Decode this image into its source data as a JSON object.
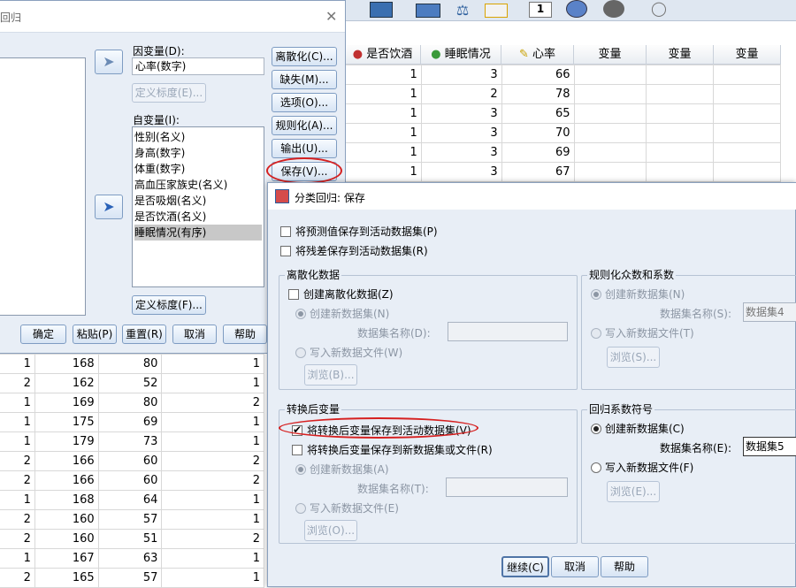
{
  "left_dialog": {
    "title_fragment": "回归",
    "dependent_label": "因变量(D):",
    "dependent_value": "心率(数字)",
    "define_scale_dep": "定义标度(E)...",
    "independent_label": "自变量(I):",
    "independent_items": [
      "性别(名义)",
      "身高(数字)",
      "体重(数字)",
      "高血压家族史(名义)",
      "是否吸烟(名义)",
      "是否饮酒(名义)",
      "睡眠情况(有序)"
    ],
    "define_scale_indep": "定义标度(F)...",
    "side_buttons": [
      "离散化(C)...",
      "缺失(M)...",
      "选项(O)...",
      "规则化(A)...",
      "输出(U)...",
      "保存(V)..."
    ],
    "bottom_buttons": [
      "确定",
      "粘贴(P)",
      "重置(R)",
      "取消",
      "帮助"
    ]
  },
  "top_grid": {
    "headers": [
      "是否饮酒",
      "睡眠情况",
      "心率",
      "变量",
      "变量",
      "变量"
    ],
    "rows": [
      [
        "1",
        "3",
        "66"
      ],
      [
        "1",
        "2",
        "78"
      ],
      [
        "1",
        "3",
        "65"
      ],
      [
        "1",
        "3",
        "70"
      ],
      [
        "1",
        "3",
        "69"
      ],
      [
        "1",
        "3",
        "67"
      ]
    ]
  },
  "bottom_grid": {
    "rows": [
      [
        "1",
        "168",
        "80",
        "1"
      ],
      [
        "2",
        "162",
        "52",
        "1"
      ],
      [
        "1",
        "169",
        "80",
        "2"
      ],
      [
        "1",
        "175",
        "69",
        "1"
      ],
      [
        "1",
        "179",
        "73",
        "1"
      ],
      [
        "2",
        "166",
        "60",
        "2"
      ],
      [
        "2",
        "166",
        "60",
        "2"
      ],
      [
        "1",
        "168",
        "64",
        "1"
      ],
      [
        "2",
        "160",
        "57",
        "1"
      ],
      [
        "2",
        "160",
        "51",
        "2"
      ],
      [
        "1",
        "167",
        "63",
        "1"
      ],
      [
        "2",
        "165",
        "57",
        "1"
      ]
    ]
  },
  "save_dialog": {
    "title": "分类回归: 保存",
    "save_predicted": "将预测值保存到活动数据集(P)",
    "save_residuals": "将残差保存到活动数据集(R)",
    "discretized_group": {
      "title": "离散化数据",
      "create_discretized": "创建离散化数据(Z)",
      "create_new_dataset": "创建新数据集(N)",
      "dataset_name_label": "数据集名称(D):",
      "write_new_file": "写入新数据文件(W)",
      "browse": "浏览(B)..."
    },
    "regularized_group": {
      "title": "规则化众数和系数",
      "create_new_dataset": "创建新数据集(N)",
      "dataset_name_label": "数据集名称(S):",
      "dataset_name_value": "数据集4",
      "write_new_file": "写入新数据文件(T)",
      "browse": "浏览(S)..."
    },
    "transformed_group": {
      "title": "转换后变量",
      "save_active": "将转换后变量保存到活动数据集(V)",
      "save_new": "将转换后变量保存到新数据集或文件(R)",
      "create_new_dataset": "创建新数据集(A)",
      "dataset_name_label": "数据集名称(T):",
      "write_new_file": "写入新数据文件(E)",
      "browse": "浏览(O)..."
    },
    "coef_group": {
      "title": "回归系数符号",
      "create_new_dataset": "创建新数据集(C)",
      "dataset_name_label": "数据集名称(E):",
      "dataset_name_value": "数据集5",
      "write_new_file": "写入新数据文件(F)",
      "browse": "浏览(E)..."
    },
    "buttons": [
      "继续(C)",
      "取消",
      "帮助"
    ]
  },
  "colors": {
    "highlight_ellipse": "#d62020",
    "dialog_bg": "#e8eef6",
    "toolbar_bg": "#dfe7f1"
  }
}
